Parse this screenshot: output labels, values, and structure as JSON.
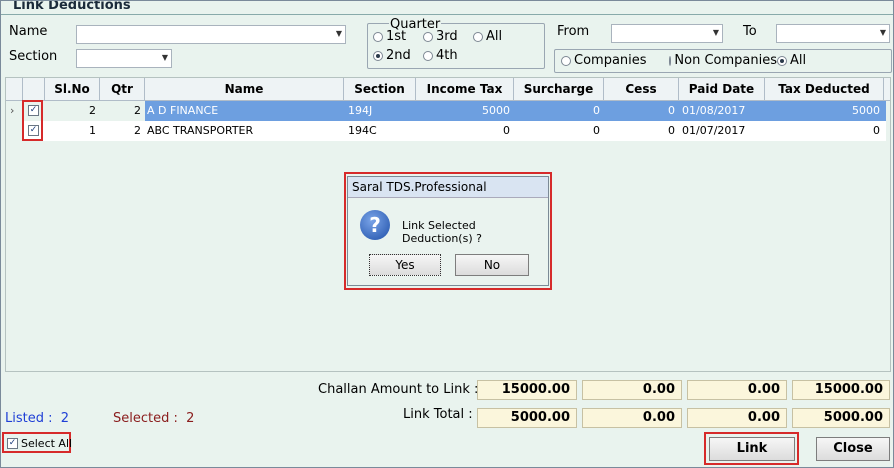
{
  "window": {
    "title": "Link Deductions"
  },
  "filters": {
    "name_label": "Name",
    "section_label": "Section",
    "quarter": {
      "label": "Quarter",
      "options": [
        "1st",
        "3rd",
        "All",
        "2nd",
        "4th"
      ],
      "selected": "2nd"
    },
    "from_label": "From",
    "to_label": "To",
    "type": {
      "options": [
        "Companies",
        "Non Companies",
        "All"
      ],
      "selected": "All"
    }
  },
  "grid": {
    "columns": [
      "Sl.No",
      "Qtr",
      "Name",
      "Section",
      "Income Tax",
      "Surcharge",
      "Cess",
      "Paid Date",
      "Tax Deducted"
    ],
    "rows": [
      {
        "slno": "2",
        "qtr": "2",
        "name": "A D FINANCE",
        "section": "194J",
        "income_tax": "5000",
        "surcharge": "0",
        "cess": "0",
        "paid_date": "01/08/2017",
        "tax_deducted": "5000",
        "checked": true,
        "selected": true
      },
      {
        "slno": "1",
        "qtr": "2",
        "name": "ABC TRANSPORTER",
        "section": "194C",
        "income_tax": "0",
        "surcharge": "0",
        "cess": "0",
        "paid_date": "01/07/2017",
        "tax_deducted": "0",
        "checked": true,
        "selected": false
      }
    ]
  },
  "dialog": {
    "title": "Saral TDS.Professional",
    "message": "Link Selected Deduction(s) ?",
    "yes_label": "Yes",
    "no_label": "No"
  },
  "totals": {
    "challan_label": "Challan Amount to Link :",
    "challan_values": [
      "15000.00",
      "0.00",
      "0.00",
      "15000.00"
    ],
    "link_total_label": "Link Total :",
    "link_total_values": [
      "5000.00",
      "0.00",
      "0.00",
      "5000.00"
    ]
  },
  "status": {
    "listed": "Listed :  2",
    "selected": "Selected :  2"
  },
  "select_all_label": "Select All",
  "buttons": {
    "link": "Link",
    "close": "Close"
  },
  "colors": {
    "selected_row": "#6d9fe0",
    "highlight": "#d62a2a",
    "listed": "#1f3fd6",
    "selected_text": "#8a1c1c"
  }
}
